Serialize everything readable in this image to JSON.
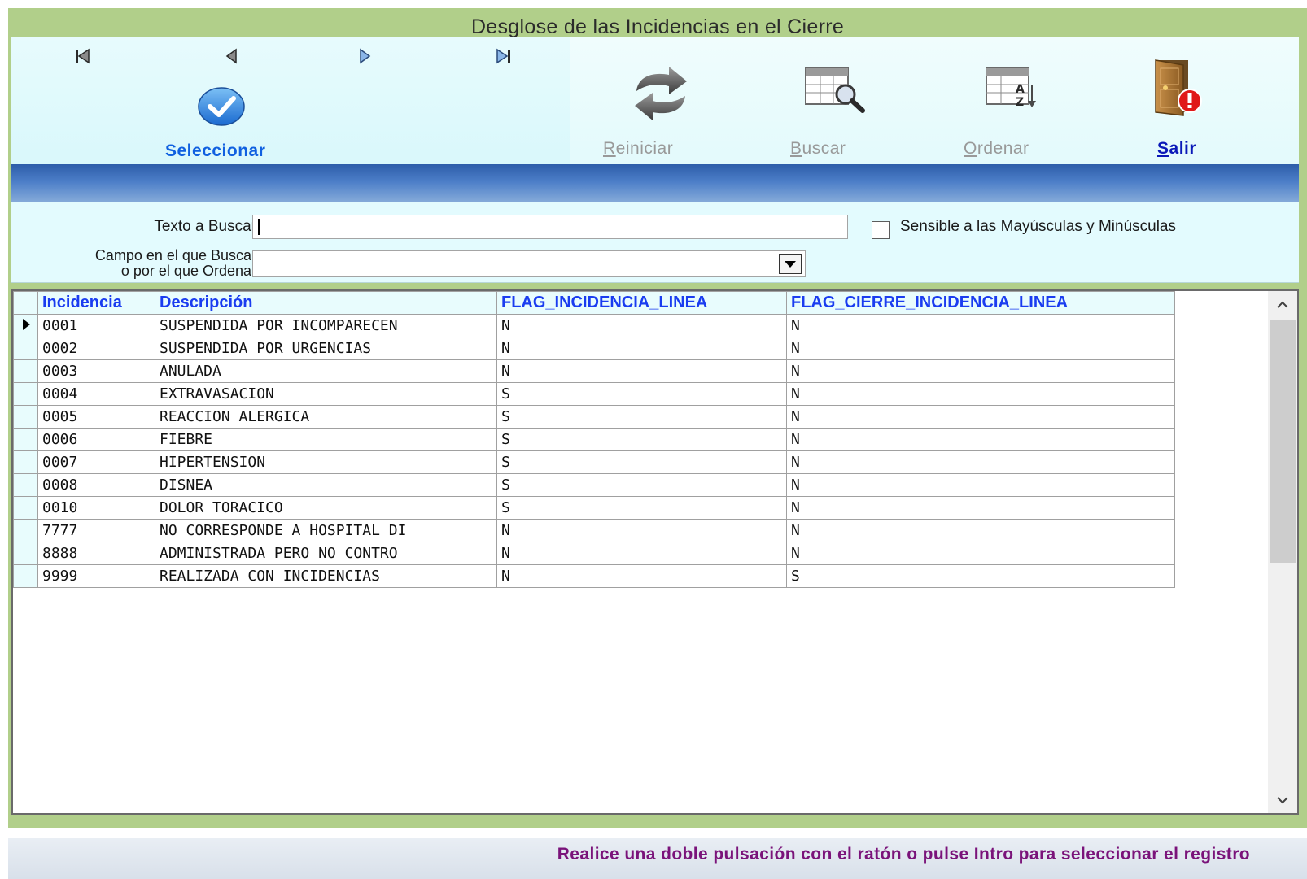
{
  "window": {
    "title": "Desglose de las Incidencias en el Cierre"
  },
  "toolbar": {
    "select_label": "Seleccionar",
    "restart_label": "Reiniciar",
    "restart_mnemonic": "R",
    "restart_rest": "einiciar",
    "search_label": "Buscar",
    "search_mnemonic": "B",
    "search_rest": "uscar",
    "sort_label": "Ordenar",
    "sort_mnemonic": "O",
    "sort_rest": "rdenar",
    "exit_label": "Salir",
    "exit_mnemonic": "S",
    "exit_rest": "alir",
    "icons": [
      "first-record-icon",
      "previous-record-icon",
      "next-record-icon",
      "last-record-icon",
      "checkmark-icon",
      "refresh-arrows-icon",
      "table-search-icon",
      "table-sort-icon",
      "exit-door-icon"
    ]
  },
  "search": {
    "text_label": "Texto a Buscar",
    "text_value": "",
    "case_sensitive_label": "Sensible a las Mayúsculas y Minúsculas",
    "case_sensitive_checked": false,
    "field_label_line1": "Campo en el que Buscar",
    "field_label_line2": "o por el que Ordenar",
    "field_value": ""
  },
  "grid": {
    "columns": [
      "Incidencia",
      "Descripción",
      "FLAG_INCIDENCIA_LINEA",
      "FLAG_CIERRE_INCIDENCIA_LINEA"
    ],
    "rows": [
      [
        "0001",
        "SUSPENDIDA POR INCOMPARECEN",
        "N",
        "N"
      ],
      [
        "0002",
        "SUSPENDIDA POR URGENCIAS",
        "N",
        "N"
      ],
      [
        "0003",
        "ANULADA",
        "N",
        "N"
      ],
      [
        "0004",
        "EXTRAVASACION",
        "S",
        "N"
      ],
      [
        "0005",
        "REACCION ALERGICA",
        "S",
        "N"
      ],
      [
        "0006",
        "FIEBRE",
        "S",
        "N"
      ],
      [
        "0007",
        "HIPERTENSION",
        "S",
        "N"
      ],
      [
        "0008",
        "DISNEA",
        "S",
        "N"
      ],
      [
        "0010",
        "DOLOR TORACICO",
        "S",
        "N"
      ],
      [
        "7777",
        "NO CORRESPONDE A HOSPITAL DI",
        "N",
        "N"
      ],
      [
        "8888",
        "ADMINISTRADA PERO NO CONTRO",
        "N",
        "N"
      ],
      [
        "9999",
        "REALIZADA CON INCIDENCIAS",
        "N",
        "S"
      ]
    ],
    "current_row": 0
  },
  "status": {
    "text": "Realice una doble pulsación con el ratón o pulse Intro para seleccionar el registro"
  },
  "colors": {
    "frame": "#b1cf8a",
    "toolbar_bg": "#e7fbfd",
    "band": "#3f6fb9",
    "header_text": "#1a3cf0",
    "status_text": "#7a137a"
  }
}
